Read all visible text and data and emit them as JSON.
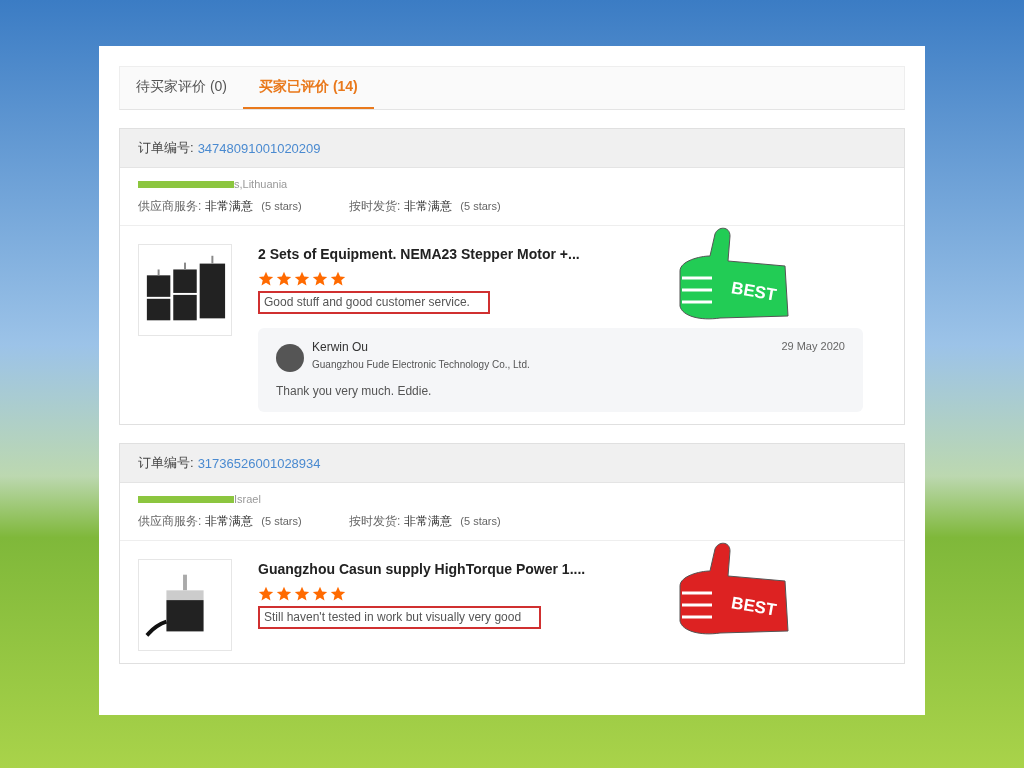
{
  "tabs": [
    {
      "label": "待买家评价 (0)",
      "selected": false
    },
    {
      "label": "买家已评价 (14)",
      "selected": true
    }
  ],
  "orders": [
    {
      "order_label": "订单编号:",
      "order_number": "34748091001020209",
      "buyer_location": "s,Lithuania",
      "ratings": [
        {
          "label": "供应商服务:",
          "value": "非常满意",
          "note": "(5 stars)"
        },
        {
          "label": "按时发货:",
          "value": "非常满意",
          "note": "(5 stars)"
        }
      ],
      "product_title": "2 Sets of Equipment. NEMA23 Stepper Motor +...",
      "kind": "multi",
      "stars": 5,
      "comment": "Good stuff and good customer service.",
      "sticker": {
        "text": "BEST",
        "color": "#22cc55"
      },
      "reply": {
        "name": "Kerwin Ou",
        "company": "Guangzhou Fude Electronic Technology Co., Ltd.",
        "date": "29 May 2020",
        "text": "Thank you very much. Eddie."
      }
    },
    {
      "order_label": "订单编号:",
      "order_number": "31736526001028934",
      "buyer_location": "Israel",
      "ratings": [
        {
          "label": "供应商服务:",
          "value": "非常满意",
          "note": "(5 stars)"
        },
        {
          "label": "按时发货:",
          "value": "非常满意",
          "note": "(5 stars)"
        }
      ],
      "product_title": "Guangzhou Casun supply HighTorque Power 1....",
      "kind": "single",
      "stars": 5,
      "comment": "Still haven't tested in work but visually very good",
      "sticker": {
        "text": "BEST",
        "color": "#dd2222"
      }
    }
  ]
}
